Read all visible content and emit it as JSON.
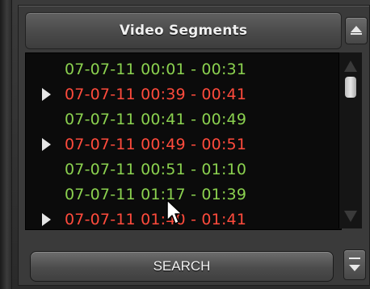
{
  "panel": {
    "title": "Video Segments",
    "collapse_icon": "chevron-up-icon",
    "dropdown_icon": "chevron-down-icon"
  },
  "segments": [
    {
      "label": "07-07-11 00:01 - 00:31",
      "status": "normal",
      "marker": false
    },
    {
      "label": "07-07-11 00:39 - 00:41",
      "status": "alert",
      "marker": true
    },
    {
      "label": "07-07-11 00:41 - 00:49",
      "status": "normal",
      "marker": false
    },
    {
      "label": "07-07-11 00:49 - 00:51",
      "status": "alert",
      "marker": true
    },
    {
      "label": "07-07-11 00:51 - 01:10",
      "status": "normal",
      "marker": false
    },
    {
      "label": "07-07-11 01:17 - 01:39",
      "status": "normal",
      "marker": false
    },
    {
      "label": "07-07-11 01:40 - 01:41",
      "status": "alert",
      "marker": true
    }
  ],
  "colors": {
    "normal": "#8bd14f",
    "alert": "#ff4b3c"
  },
  "search": {
    "label": "SEARCH"
  }
}
